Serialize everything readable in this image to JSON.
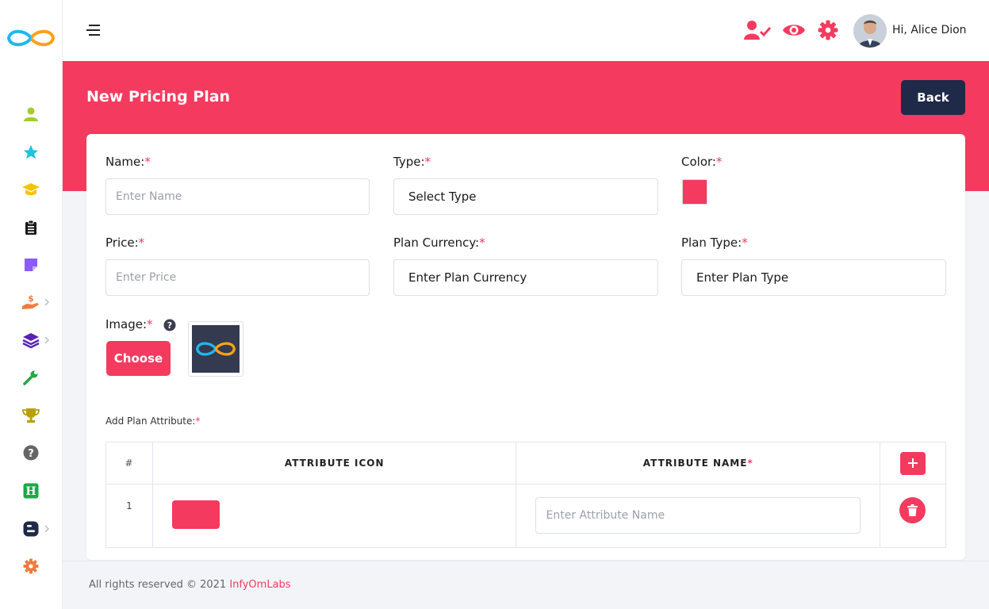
{
  "header": {
    "greeting_prefix": "Hi,",
    "user_name": "Alice Dion",
    "icons": [
      "user-check-icon",
      "eye-icon",
      "gear-icon"
    ]
  },
  "sidebar": {
    "items": [
      {
        "icon": "user-icon",
        "color": "#a3cc2e"
      },
      {
        "icon": "star-icon",
        "color": "#1fc2e0"
      },
      {
        "icon": "graduation-cap-icon",
        "color": "#f5c400"
      },
      {
        "icon": "clipboard-icon",
        "color": "#1a1a1a"
      },
      {
        "icon": "sticky-note-icon",
        "color": "#8b5cf6"
      },
      {
        "icon": "hand-dollar-icon",
        "color": "#f07b3f",
        "has_submenu": true
      },
      {
        "icon": "layers-icon",
        "color": "#5b21b6",
        "has_submenu": true
      },
      {
        "icon": "wrench-icon",
        "color": "#22a844"
      },
      {
        "icon": "trophy-icon",
        "color": "#b8a000"
      },
      {
        "icon": "question-circle-icon",
        "color": "#666666"
      },
      {
        "icon": "h-square-icon",
        "color": "#1aa94a"
      },
      {
        "icon": "blogger-icon",
        "color": "#1e2a47",
        "has_submenu": true
      },
      {
        "icon": "cog-icon",
        "color": "#f07b3f"
      }
    ]
  },
  "page": {
    "title": "New Pricing Plan",
    "back_label": "Back"
  },
  "form": {
    "name_label": "Name:",
    "name_placeholder": "Enter Name",
    "type_label": "Type:",
    "type_value": "Select Type",
    "color_label": "Color:",
    "color_value": "#f43a5e",
    "price_label": "Price:",
    "price_placeholder": "Enter Price",
    "currency_label": "Plan Currency:",
    "currency_value": "Enter Plan Currency",
    "plan_type_label": "Plan Type:",
    "plan_type_value": "Enter Plan Type",
    "image_label": "Image:",
    "choose_label": "Choose",
    "required_mark": "*"
  },
  "attributes": {
    "title": "Add Plan Attribute:",
    "col_index": "#",
    "col_icon": "ATTRIBUTE ICON",
    "col_name": "ATTRIBUTE NAME",
    "rows": [
      {
        "index": "1",
        "name_placeholder": "Enter Attribute Name"
      }
    ]
  },
  "footer": {
    "text": "All rights reserved © 2021",
    "link": "InfyOmLabs"
  },
  "colors": {
    "accent": "#f43a5e",
    "dark": "#1e2a47"
  }
}
